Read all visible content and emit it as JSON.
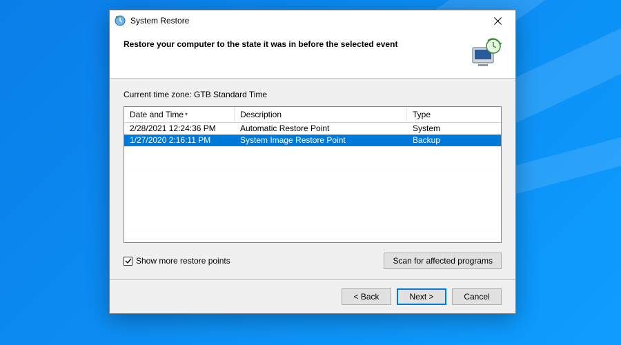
{
  "window": {
    "title": "System Restore",
    "heading": "Restore your computer to the state it was in before the selected event"
  },
  "timezone_label": "Current time zone: GTB Standard Time",
  "listview": {
    "columns": {
      "date": "Date and Time",
      "description": "Description",
      "type": "Type"
    },
    "rows": [
      {
        "date": "2/28/2021 12:24:36 PM",
        "description": "Automatic Restore Point",
        "type": "System",
        "selected": false
      },
      {
        "date": "1/27/2020 2:16:11 PM",
        "description": "System Image Restore Point",
        "type": "Backup",
        "selected": true
      }
    ]
  },
  "checkbox": {
    "label": "Show more restore points",
    "checked": true
  },
  "buttons": {
    "scan": "Scan for affected programs",
    "back": "< Back",
    "next": "Next >",
    "cancel": "Cancel"
  }
}
